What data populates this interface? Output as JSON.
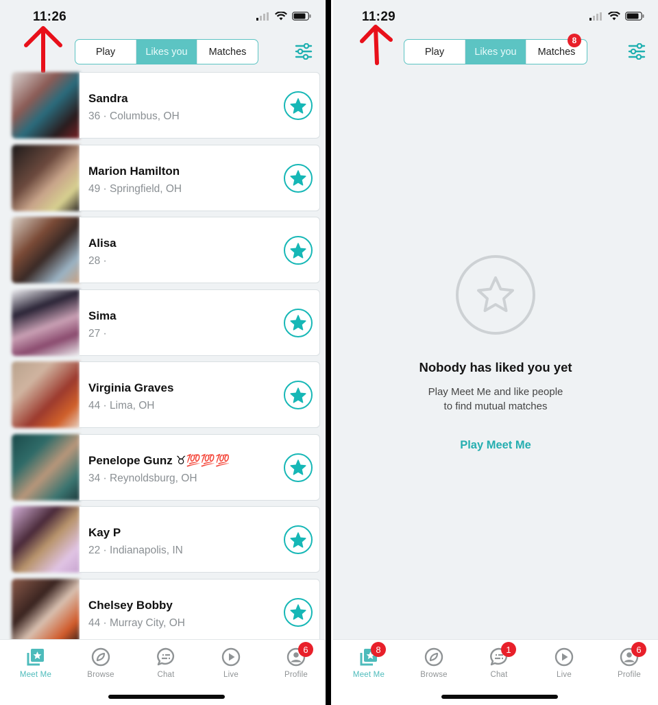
{
  "colors": {
    "accent": "#5cc4c3",
    "star": "#16b7b6",
    "badge": "#e8202a",
    "annotation_arrow": "#e8101a"
  },
  "screens": [
    {
      "status_bar": {
        "time": "11:26",
        "icons": [
          "signal-icon",
          "wifi-icon",
          "battery-icon"
        ]
      },
      "tabs": [
        {
          "label": "Play",
          "active": false,
          "badge": null
        },
        {
          "label": "Likes you",
          "active": true,
          "badge": null
        },
        {
          "label": "Matches",
          "active": false,
          "badge": null
        }
      ],
      "filter_icon": "sliders-icon",
      "likes": [
        {
          "name": "Sandra",
          "details": "36 · Columbus, OH"
        },
        {
          "name": "Marion Hamilton",
          "details": "49 · Springfield, OH"
        },
        {
          "name": "Alisa",
          "details": "28 ·"
        },
        {
          "name": "Sima",
          "details": "27 ·"
        },
        {
          "name": "Virginia Graves",
          "details": "44 · Lima, OH"
        },
        {
          "name": "Penelope Gunz ♉💯💯💯",
          "details": "34 · Reynoldsburg, OH"
        },
        {
          "name": "Kay P",
          "details": "22 · Indianapolis, IN"
        },
        {
          "name": "Chelsey Bobby",
          "details": "44 · Murray City, OH"
        }
      ],
      "nav": [
        {
          "label": "Meet Me",
          "icon": "meet-me-icon",
          "active": true,
          "badge": null
        },
        {
          "label": "Browse",
          "icon": "compass-icon",
          "active": false,
          "badge": null
        },
        {
          "label": "Chat",
          "icon": "chat-icon",
          "active": false,
          "badge": null
        },
        {
          "label": "Live",
          "icon": "play-icon",
          "active": false,
          "badge": null
        },
        {
          "label": "Profile",
          "icon": "profile-icon",
          "active": false,
          "badge": "6"
        }
      ]
    },
    {
      "status_bar": {
        "time": "11:29",
        "icons": [
          "signal-icon",
          "wifi-icon",
          "battery-icon"
        ]
      },
      "tabs": [
        {
          "label": "Play",
          "active": false,
          "badge": null
        },
        {
          "label": "Likes you",
          "active": true,
          "badge": null
        },
        {
          "label": "Matches",
          "active": false,
          "badge": "8"
        }
      ],
      "filter_icon": "sliders-icon",
      "empty_state": {
        "icon": "star-outline-icon",
        "title": "Nobody has liked you yet",
        "description_line1": "Play Meet Me and like people",
        "description_line2": "to find mutual matches",
        "cta": "Play Meet Me"
      },
      "nav": [
        {
          "label": "Meet Me",
          "icon": "meet-me-icon",
          "active": true,
          "badge": "8"
        },
        {
          "label": "Browse",
          "icon": "compass-icon",
          "active": false,
          "badge": null
        },
        {
          "label": "Chat",
          "icon": "chat-icon",
          "active": false,
          "badge": "1"
        },
        {
          "label": "Live",
          "icon": "play-icon",
          "active": false,
          "badge": null
        },
        {
          "label": "Profile",
          "icon": "profile-icon",
          "active": false,
          "badge": "6"
        }
      ]
    }
  ]
}
